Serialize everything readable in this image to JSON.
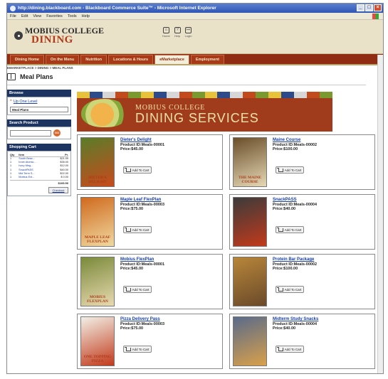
{
  "window": {
    "title": "http://dining.blackboard.com - Blackboard Commerce Suite™ - Microsoft Internet Explorer",
    "buttons": [
      "_",
      "□",
      "×"
    ]
  },
  "menubar": [
    "File",
    "Edit",
    "View",
    "Favorites",
    "Tools",
    "Help"
  ],
  "header": {
    "logo_line1": "MOBIUS COLLEGE",
    "logo_line2": "DINING",
    "utilities": [
      {
        "icon": "home-icon",
        "label": "Home"
      },
      {
        "icon": "help-icon",
        "label": "Help"
      },
      {
        "icon": "logout-icon",
        "label": "Login"
      }
    ]
  },
  "nav": {
    "tabs": [
      "Dining Home",
      "On the Menu",
      "Nutrition",
      "Locations & Hours",
      "eMarketplace",
      "Employment"
    ],
    "active": "eMarketplace"
  },
  "breadcrumb": "EMARKETPLACE > DINING > MEAL PLANS",
  "page_title": "Meal Plans",
  "sidebar": {
    "browse": {
      "title": "Browse",
      "up_link": "Up One Level",
      "current": "Meal Plans"
    },
    "search": {
      "title": "Search Product",
      "go": "GO",
      "value": ""
    },
    "cart": {
      "title": "Shopping Cart",
      "headers": [
        "Qty",
        "Item",
        "Pr."
      ],
      "items": [
        {
          "qty": "1",
          "item": "South Beac...",
          "price": "$21.99"
        },
        {
          "qty": "1",
          "item": "Inner Atomic...",
          "price": "$35.00"
        },
        {
          "qty": "1",
          "item": "Ivory Meg...",
          "price": "$12.00"
        },
        {
          "qty": "1",
          "item": "SnackPASS",
          "price": "$40.00"
        },
        {
          "qty": "1",
          "item": "Mid Term S...",
          "price": "$22.00"
        },
        {
          "qty": "1",
          "item": "Mobius Ext...",
          "price": "$ 0.00"
        }
      ],
      "total": "$109.90",
      "checkout": "Checkout"
    }
  },
  "banner": {
    "line1": "MOBIUS COLLEGE",
    "line2": "DINING SERVICES",
    "stripe_colors": [
      "#e8c23a",
      "#2d4a8a",
      "#d7d7d7",
      "#c24a1c",
      "#7a9a2f",
      "#e8c23a",
      "#2d4a8a",
      "#d7d7d7",
      "#c24a1c",
      "#7a9a2f",
      "#e8c23a",
      "#2d4a8a",
      "#d7d7d7",
      "#c24a1c",
      "#7a9a2f",
      "#e8c23a",
      "#2d4a8a",
      "#d7d7d7",
      "#c24a1c",
      "#7a9a2f"
    ]
  },
  "products": [
    {
      "name": "Dieter's Delight",
      "id": "Product ID:Meals-00001",
      "price": "Price:$45.00",
      "caption": "DIETER'S DELIGHT",
      "button": "Add To Cart",
      "colors": [
        "#5a7d2a",
        "#c84a1c"
      ]
    },
    {
      "name": "Maine Course",
      "id": "Product ID:Meals-00002",
      "price": "Price:$100.00",
      "caption": "THE MAINE COURSE",
      "button": "Add To Cart",
      "colors": [
        "#6b4e2a",
        "#e5d8b5"
      ]
    },
    {
      "name": "Maple Leaf FlexPlan",
      "id": "Product ID:Meals-00003",
      "price": "Price:$75.00",
      "caption": "MAPLE LEAF FLEXPLAN",
      "button": "Add To Cart",
      "colors": [
        "#d06a1e",
        "#f0d9a0"
      ]
    },
    {
      "name": "SnackPASS",
      "id": "Product ID:Meals-00004",
      "price": "Price:$40.00",
      "caption": "SNACKPASS",
      "button": "Add To Cart",
      "colors": [
        "#3b3b3b",
        "#c23a1c"
      ]
    },
    {
      "name": "Mobius FlexPlan",
      "id": "Product ID:Meals-00001",
      "price": "Price:$45.00",
      "caption": "MOBIUS FLEXPLAN",
      "button": "Add To Cart",
      "colors": [
        "#7a8a3a",
        "#e8d9b0"
      ]
    },
    {
      "name": "Protein Bar Package",
      "id": "Product ID:Meals-00002",
      "price": "Price:$100.00",
      "caption": "",
      "button": "Add To Cart",
      "colors": [
        "#b8863a",
        "#6a4a2a"
      ]
    },
    {
      "name": "Pizza Delivery Pass",
      "id": "Product ID:Meals-00003",
      "price": "Price:$75.00",
      "caption": "ONE TOPPING PIZZA",
      "button": "Add To Cart",
      "colors": [
        "#f2efe6",
        "#c23a1c"
      ]
    },
    {
      "name": "Midterm Study Snacks",
      "id": "Product ID:Meals-00004",
      "price": "Price:$40.00",
      "caption": "",
      "button": "Add To Cart",
      "colors": [
        "#5a6b8a",
        "#d9a04a"
      ]
    }
  ]
}
